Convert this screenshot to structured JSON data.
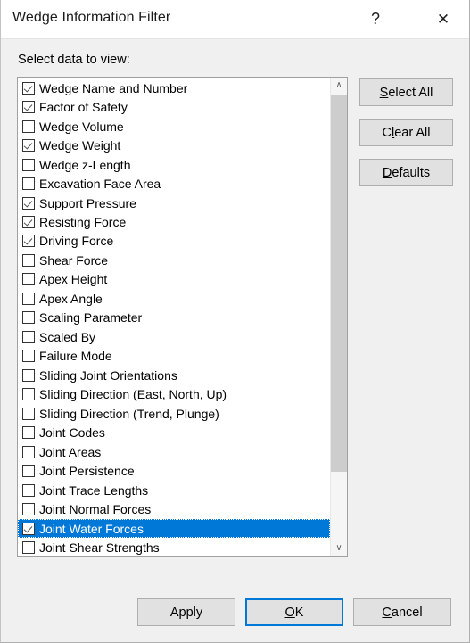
{
  "window": {
    "title": "Wedge Information Filter",
    "help_glyph": "?",
    "close_glyph": "✕"
  },
  "content": {
    "select_label": "Select data to view:"
  },
  "list": {
    "items": [
      {
        "label": "Wedge Name and Number",
        "checked": true,
        "selected": false
      },
      {
        "label": "Factor of Safety",
        "checked": true,
        "selected": false
      },
      {
        "label": "Wedge Volume",
        "checked": false,
        "selected": false
      },
      {
        "label": "Wedge Weight",
        "checked": true,
        "selected": false
      },
      {
        "label": "Wedge z-Length",
        "checked": false,
        "selected": false
      },
      {
        "label": "Excavation Face Area",
        "checked": false,
        "selected": false
      },
      {
        "label": "Support Pressure",
        "checked": true,
        "selected": false
      },
      {
        "label": "Resisting Force",
        "checked": true,
        "selected": false
      },
      {
        "label": "Driving Force",
        "checked": true,
        "selected": false
      },
      {
        "label": "Shear Force",
        "checked": false,
        "selected": false
      },
      {
        "label": "Apex Height",
        "checked": false,
        "selected": false
      },
      {
        "label": "Apex Angle",
        "checked": false,
        "selected": false
      },
      {
        "label": "Scaling Parameter",
        "checked": false,
        "selected": false
      },
      {
        "label": "Scaled By",
        "checked": false,
        "selected": false
      },
      {
        "label": "Failure Mode",
        "checked": false,
        "selected": false
      },
      {
        "label": "Sliding Joint Orientations",
        "checked": false,
        "selected": false
      },
      {
        "label": "Sliding Direction (East, North, Up)",
        "checked": false,
        "selected": false
      },
      {
        "label": "Sliding Direction (Trend, Plunge)",
        "checked": false,
        "selected": false
      },
      {
        "label": "Joint Codes",
        "checked": false,
        "selected": false
      },
      {
        "label": "Joint Areas",
        "checked": false,
        "selected": false
      },
      {
        "label": "Joint Persistence",
        "checked": false,
        "selected": false
      },
      {
        "label": "Joint Trace Lengths",
        "checked": false,
        "selected": false
      },
      {
        "label": "Joint Normal Forces",
        "checked": false,
        "selected": false
      },
      {
        "label": "Joint Water Forces",
        "checked": true,
        "selected": true
      },
      {
        "label": "Joint Shear Strengths",
        "checked": false,
        "selected": false
      }
    ],
    "scrollbar": {
      "up_glyph": "∧",
      "down_glyph": "∨"
    }
  },
  "side_buttons": [
    {
      "name": "select-all",
      "pre": "",
      "accel": "S",
      "post": "elect All"
    },
    {
      "name": "clear-all",
      "pre": "C",
      "accel": "l",
      "post": "ear All"
    },
    {
      "name": "defaults",
      "pre": "",
      "accel": "D",
      "post": "efaults"
    }
  ],
  "bottom_buttons": [
    {
      "name": "apply",
      "pre": "Apply",
      "accel": "",
      "post": ""
    },
    {
      "name": "ok",
      "pre": "",
      "accel": "O",
      "post": "K"
    },
    {
      "name": "cancel",
      "pre": "",
      "accel": "C",
      "post": "ancel"
    }
  ],
  "colors": {
    "dialog_background": "#f0f0f0",
    "titlebar_background": "#ffffff",
    "selection_highlight": "#0078d7",
    "focus_border": "#0078d7",
    "button_face": "#e1e1e1",
    "scrollbar_thumb": "#cdcdcd"
  }
}
